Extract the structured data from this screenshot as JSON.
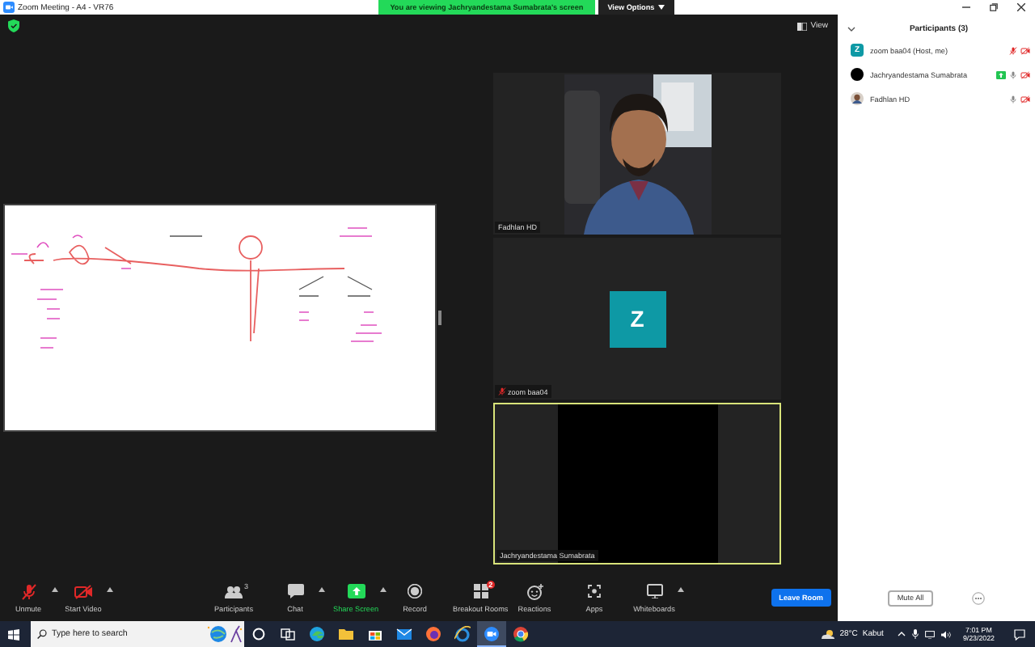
{
  "window": {
    "title": "Zoom Meeting - A4 - VR76"
  },
  "banner": {
    "text": "You are viewing Jachryandestama Sumabrata's screen",
    "menu": "View Options"
  },
  "view_button": "View",
  "tiles": [
    {
      "name": "Fadhlan HD",
      "kind": "video",
      "muted": false,
      "speaking": false
    },
    {
      "name": "zoom baa04",
      "kind": "avatar",
      "letter": "Z",
      "muted": true,
      "speaking": false
    },
    {
      "name": "Jachryandestama Sumabrata",
      "kind": "blank",
      "muted": false,
      "speaking": true
    }
  ],
  "toolbar": [
    {
      "label": "Unmute",
      "kind": "mic-off",
      "menu": true
    },
    {
      "label": "Start Video",
      "kind": "video-off",
      "menu": true
    },
    {
      "label": "Participants",
      "kind": "people",
      "count": "3",
      "menu": false
    },
    {
      "label": "Chat",
      "kind": "chat",
      "menu": true
    },
    {
      "label": "Share Screen",
      "kind": "share",
      "menu": true
    },
    {
      "label": "Record",
      "kind": "record",
      "menu": false
    },
    {
      "label": "Breakout Rooms",
      "kind": "rooms",
      "badge": "2",
      "menu": false
    },
    {
      "label": "Reactions",
      "kind": "reactions",
      "menu": false
    },
    {
      "label": "Apps",
      "kind": "apps",
      "menu": false
    },
    {
      "label": "Whiteboards",
      "kind": "whiteboard",
      "menu": true
    }
  ],
  "leave_button": "Leave Room",
  "participants": {
    "title": "Participants (3)",
    "rows": [
      {
        "name": "zoom baa04 (Host, me)",
        "kind": "letter",
        "letter": "Z",
        "sharing": false,
        "muted": true,
        "video_on": false
      },
      {
        "name": "Jachryandestama Sumabrata",
        "kind": "dark",
        "sharing": true,
        "muted": false,
        "video_on": false
      },
      {
        "name": "Fadhlan HD",
        "sharing": false,
        "muted": false,
        "video_on": false
      }
    ],
    "mute_all": "Mute All"
  },
  "taskbar": {
    "search_placeholder": "Type here to search",
    "apps": [
      {
        "kind": "circle",
        "active": false
      },
      {
        "kind": "taskview",
        "active": false
      },
      {
        "kind": "wave",
        "active": false
      },
      {
        "kind": "folder",
        "active": false
      },
      {
        "kind": "bag",
        "active": false
      },
      {
        "kind": "mail",
        "active": false
      },
      {
        "kind": "fox",
        "active": false
      },
      {
        "kind": "letter-e",
        "active": false
      },
      {
        "kind": "camera",
        "active": true
      },
      {
        "kind": "ball",
        "active": false
      }
    ],
    "temperature": "28°C",
    "weather": "Kabut",
    "time": "7:01 PM",
    "date": "9/23/2022"
  }
}
